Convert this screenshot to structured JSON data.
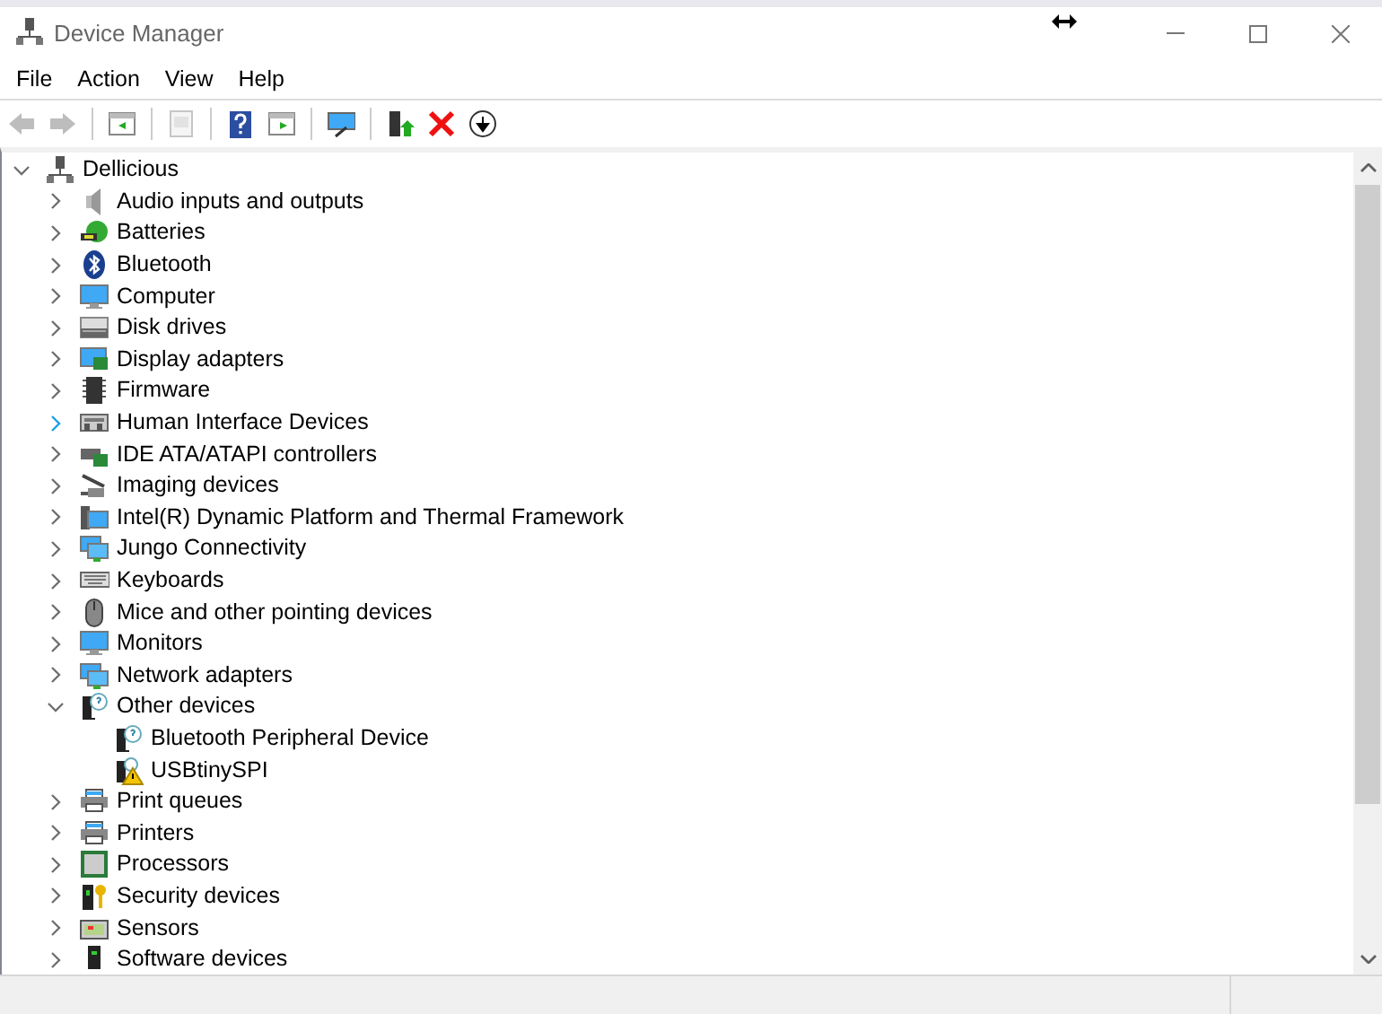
{
  "window": {
    "title": "Device Manager"
  },
  "menu": [
    {
      "label": "File"
    },
    {
      "label": "Action"
    },
    {
      "label": "View"
    },
    {
      "label": "Help"
    }
  ],
  "toolbar": [
    {
      "kind": "back",
      "disabled": true
    },
    {
      "kind": "forward",
      "disabled": true
    },
    {
      "kind": "sep"
    },
    {
      "kind": "console-tree",
      "disabled": false
    },
    {
      "kind": "sep"
    },
    {
      "kind": "properties",
      "disabled": true
    },
    {
      "kind": "sep"
    },
    {
      "kind": "help",
      "disabled": false
    },
    {
      "kind": "action-pane",
      "disabled": false
    },
    {
      "kind": "sep"
    },
    {
      "kind": "scan",
      "disabled": false
    },
    {
      "kind": "sep"
    },
    {
      "kind": "update",
      "disabled": false
    },
    {
      "kind": "uninstall",
      "disabled": false
    },
    {
      "kind": "download",
      "disabled": false
    }
  ],
  "tree": {
    "label": "Dellicious",
    "kind": "computer-root",
    "expanded": true,
    "hovered": false,
    "children": [
      {
        "label": "Audio inputs and outputs",
        "kind": "speaker",
        "expanded": false,
        "hovered": false
      },
      {
        "label": "Batteries",
        "kind": "battery",
        "expanded": false,
        "hovered": false
      },
      {
        "label": "Bluetooth",
        "kind": "bluetooth",
        "expanded": false,
        "hovered": false
      },
      {
        "label": "Computer",
        "kind": "monitor",
        "expanded": false,
        "hovered": false
      },
      {
        "label": "Disk drives",
        "kind": "drive",
        "expanded": false,
        "hovered": false
      },
      {
        "label": "Display adapters",
        "kind": "display-adapter",
        "expanded": false,
        "hovered": false
      },
      {
        "label": "Firmware",
        "kind": "chip",
        "expanded": false,
        "hovered": false
      },
      {
        "label": "Human Interface Devices",
        "kind": "hid",
        "expanded": false,
        "hovered": true
      },
      {
        "label": "IDE ATA/ATAPI controllers",
        "kind": "controller",
        "expanded": false,
        "hovered": false
      },
      {
        "label": "Imaging devices",
        "kind": "camera",
        "expanded": false,
        "hovered": false
      },
      {
        "label": "Intel(R) Dynamic Platform and Thermal Framework",
        "kind": "folder-monitor",
        "expanded": false,
        "hovered": false
      },
      {
        "label": "Jungo Connectivity",
        "kind": "network",
        "expanded": false,
        "hovered": false
      },
      {
        "label": "Keyboards",
        "kind": "keyboard",
        "expanded": false,
        "hovered": false
      },
      {
        "label": "Mice and other pointing devices",
        "kind": "mouse",
        "expanded": false,
        "hovered": false
      },
      {
        "label": "Monitors",
        "kind": "monitor",
        "expanded": false,
        "hovered": false
      },
      {
        "label": "Network adapters",
        "kind": "network",
        "expanded": false,
        "hovered": false
      },
      {
        "label": "Other devices",
        "kind": "unknown",
        "expanded": true,
        "hovered": false,
        "children": [
          {
            "label": "Bluetooth Peripheral Device",
            "kind": "unknown",
            "hovered": false
          },
          {
            "label": "USBtinySPI",
            "kind": "warning",
            "hovered": false
          }
        ]
      },
      {
        "label": "Print queues",
        "kind": "printer",
        "expanded": false,
        "hovered": false
      },
      {
        "label": "Printers",
        "kind": "printer",
        "expanded": false,
        "hovered": false
      },
      {
        "label": "Processors",
        "kind": "processor",
        "expanded": false,
        "hovered": false
      },
      {
        "label": "Security devices",
        "kind": "security",
        "expanded": false,
        "hovered": false
      },
      {
        "label": "Sensors",
        "kind": "sensor",
        "expanded": false,
        "hovered": false
      },
      {
        "label": "Software devices",
        "kind": "software",
        "expanded": false,
        "hovered": false
      }
    ]
  }
}
